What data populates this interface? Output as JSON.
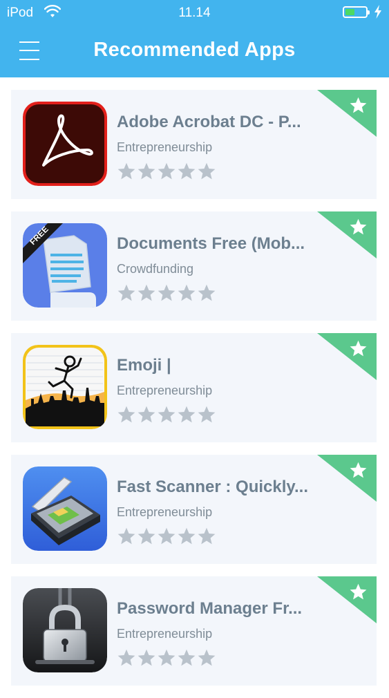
{
  "status_bar": {
    "carrier": "iPod",
    "time": "11.14",
    "battery_level": 0.45
  },
  "header": {
    "title": "Recommended Apps",
    "menu_icon": "hamburger-menu-icon"
  },
  "colors": {
    "header_bg": "#42b4ee",
    "card_bg": "#f3f6fb",
    "ribbon": "#5bc88d",
    "app_name": "#6c7f8f",
    "category": "#7f8c97",
    "star_empty": "#b9c2cb"
  },
  "apps": [
    {
      "name": "Adobe Acrobat DC - P...",
      "category": "Entrepreneurship",
      "rating": 0,
      "icon": "adobe-acrobat-icon"
    },
    {
      "name": "Documents Free (Mob...",
      "category": "Crowdfunding",
      "rating": 0,
      "icon": "documents-free-icon",
      "icon_badge": "FREE"
    },
    {
      "name": "Emoji |",
      "category": "Entrepreneurship",
      "rating": 0,
      "icon": "emoji-stick-figure-icon"
    },
    {
      "name": "Fast Scanner : Quickly...",
      "category": "Entrepreneurship",
      "rating": 0,
      "icon": "flatbed-scanner-icon"
    },
    {
      "name": "Password Manager Fr...",
      "category": "Entrepreneurship",
      "rating": 0,
      "icon": "padlock-icon"
    }
  ]
}
